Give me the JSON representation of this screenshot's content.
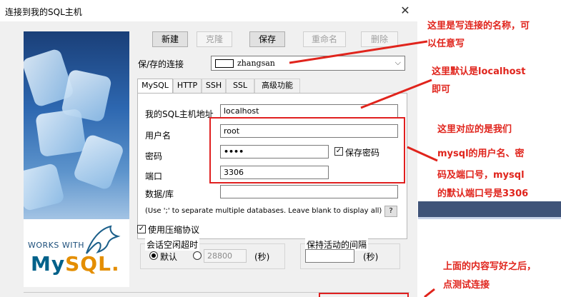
{
  "window": {
    "title": "连接到我的SQL主机",
    "close_glyph": "✕"
  },
  "toolbar": {
    "new_label": "新建",
    "clone_label": "克隆",
    "save_label": "保存",
    "rename_label": "重命名",
    "delete_label": "删除"
  },
  "saved_connection": {
    "label": "保/存的连接",
    "value": "zhangsan",
    "arrow": "⌵"
  },
  "tabs": [
    "MySQL",
    "HTTP",
    "SSH",
    "SSL",
    "高级功能"
  ],
  "form": {
    "host_label": "我的SQL主机地址",
    "host_value": "localhost",
    "user_label": "用户名",
    "user_value": "root",
    "password_label": "密码",
    "password_value": "••••",
    "save_password_label": "保存密码",
    "save_password_check": "✓",
    "port_label": "端口",
    "port_value": "3306",
    "database_label": "数据/库",
    "database_value": "",
    "database_hint": "(Use ';' to separate multiple databases. Leave blank to display all)",
    "help_label": "?",
    "compression_label": "使用压缩协议",
    "compression_check": "✓"
  },
  "idle_timeout": {
    "title": "会话空闲超时",
    "default_label": "默认",
    "custom_value": "28800",
    "unit": "(秒)"
  },
  "keepalive": {
    "title": "保持活动的间隔",
    "value": "",
    "unit": "(秒)"
  },
  "banner": {
    "works_with": "WORKS WITH",
    "my": "My",
    "sql": "SQL",
    "dot": "."
  },
  "annotations": {
    "name_line1": "这里是写连接的名称，可",
    "name_line2": "以任意写",
    "host_line1": "这里默认是localhost",
    "host_line2": "即可",
    "user_line1": "这里对应的是我们",
    "user_line2": "mysql的用户名、密",
    "user_line3": "码及端口号，mysql",
    "user_line4": "的默认端口号是3306",
    "test_line1": "上面的内容写好之后，",
    "test_line2": "点测试连接"
  },
  "colors": {
    "annotation_red": "#e0241c",
    "mysql_blue": "#00618a",
    "mysql_orange": "#e48e00"
  }
}
